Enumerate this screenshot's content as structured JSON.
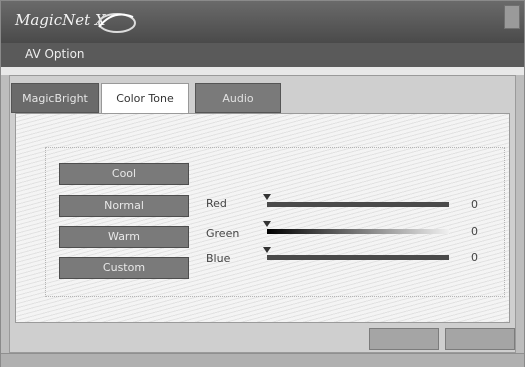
{
  "app": {
    "title": "MagicNet X",
    "window_title": "AV Option"
  },
  "tabs": [
    {
      "label": "MagicBright",
      "active": false
    },
    {
      "label": "Color Tone",
      "active": true
    },
    {
      "label": "Audio",
      "active": false
    }
  ],
  "tones": [
    {
      "label": "Cool"
    },
    {
      "label": "Normal"
    },
    {
      "label": "Warm"
    },
    {
      "label": "Custom"
    }
  ],
  "sliders": [
    {
      "label": "Red",
      "value": "0",
      "level": 0
    },
    {
      "label": "Green",
      "value": "0",
      "level": 0
    },
    {
      "label": "Blue",
      "value": "0",
      "level": 0
    }
  ],
  "buttons": {
    "apply": "",
    "cancel": ""
  },
  "icons": {
    "logo": "swirl-logo-icon",
    "close": "close-icon"
  }
}
